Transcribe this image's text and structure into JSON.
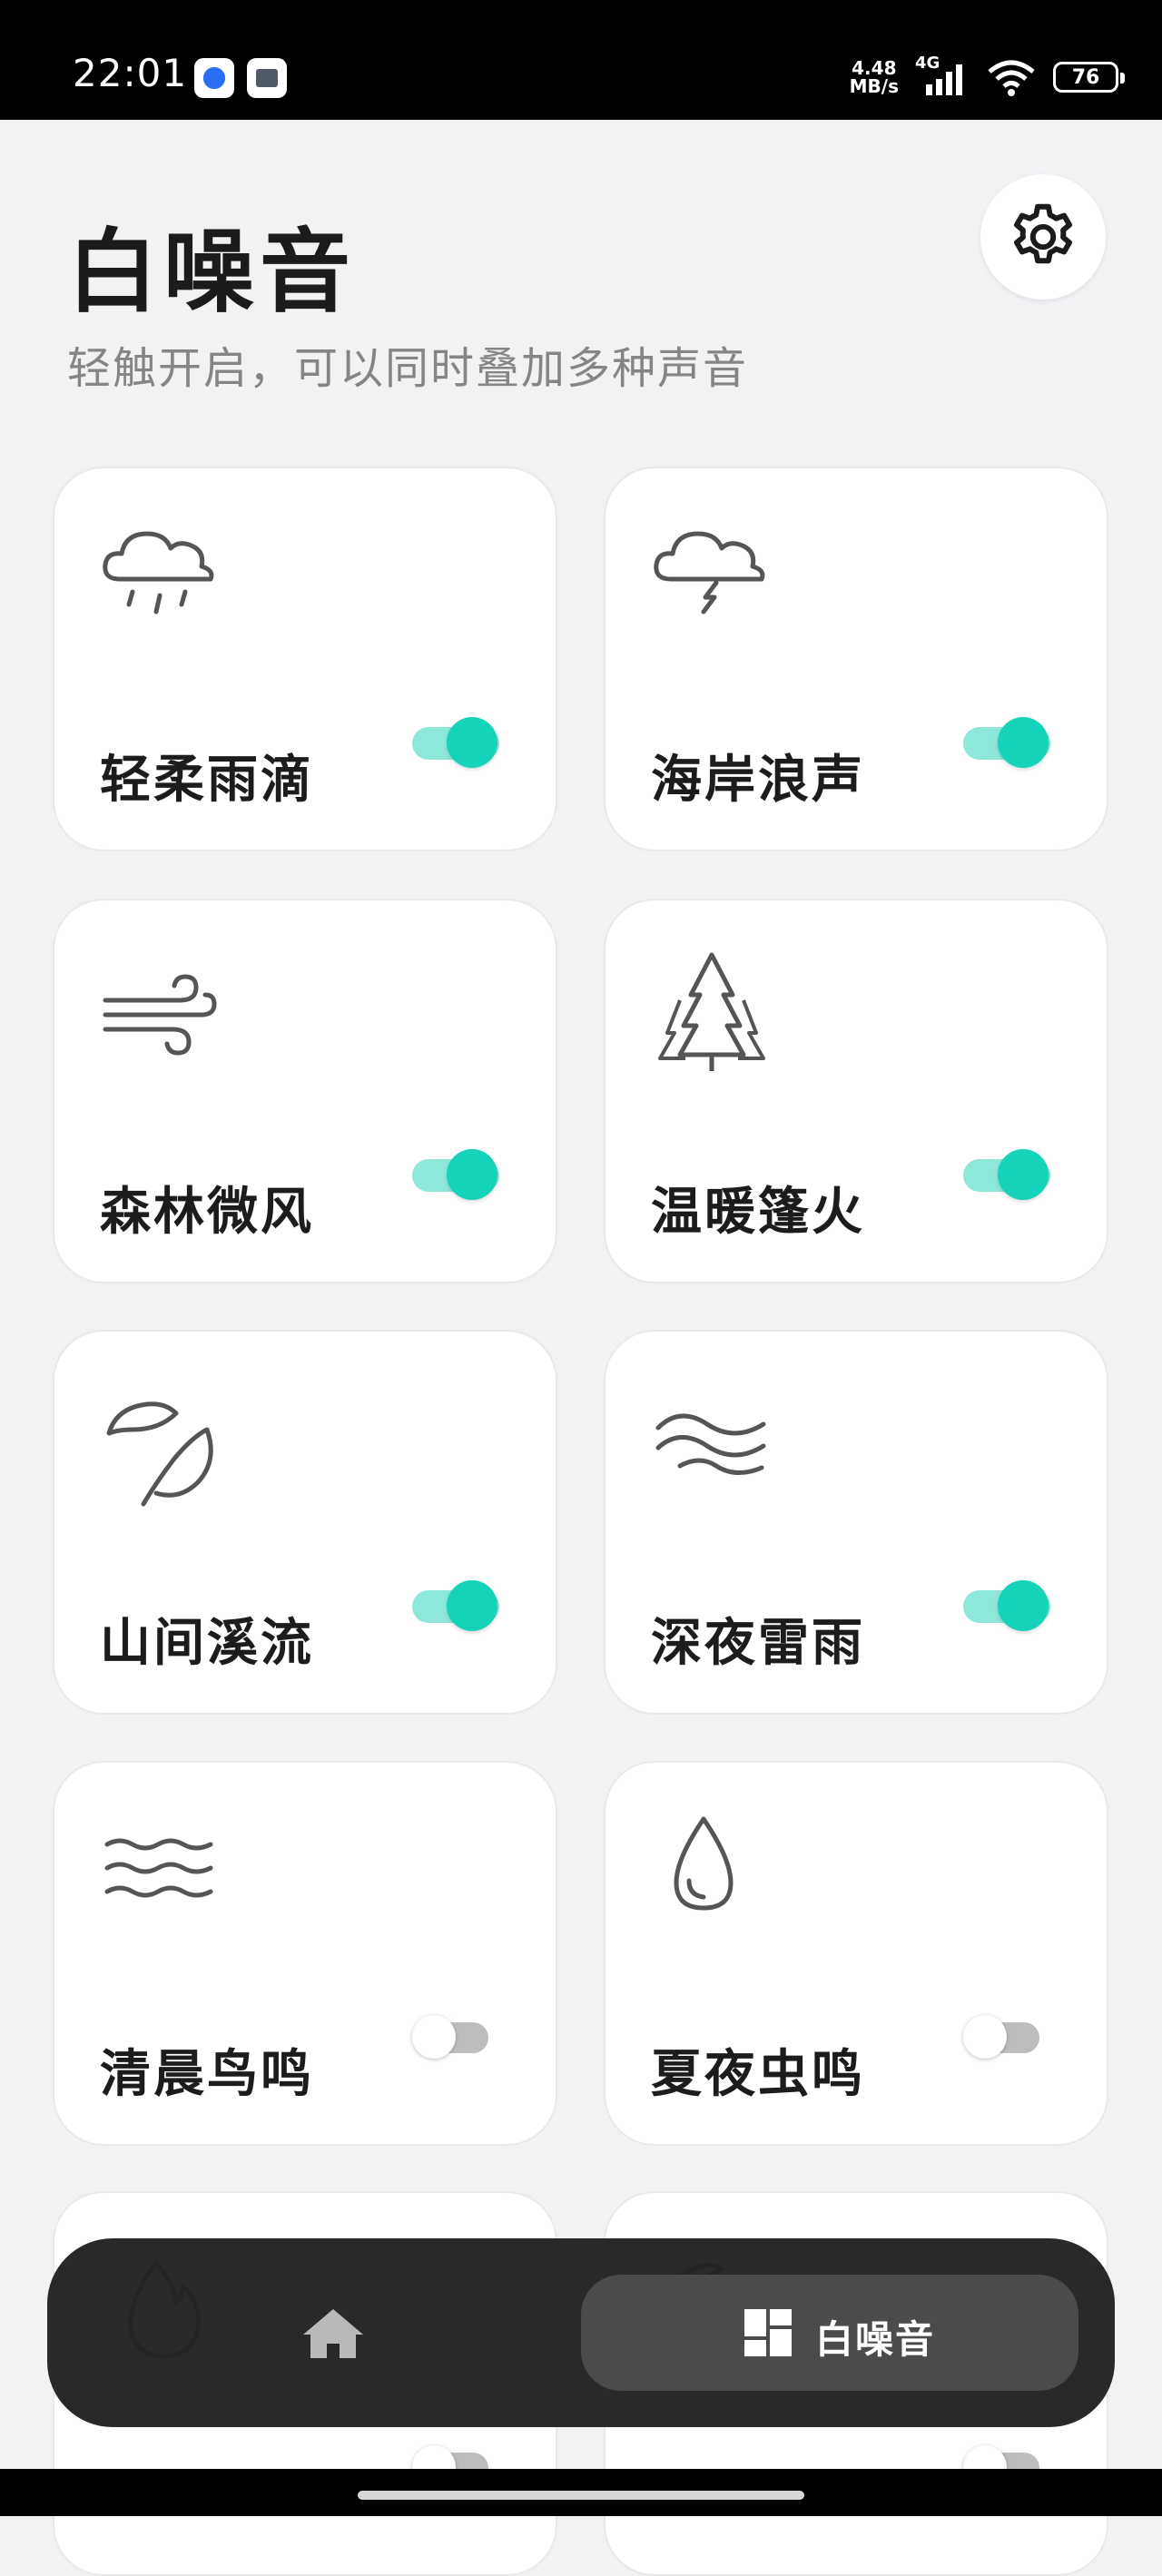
{
  "status_bar": {
    "time": "22:01",
    "speed_value": "4.48",
    "speed_unit": "MB/s",
    "network": "4G",
    "battery": "76"
  },
  "header": {
    "title": "白噪音",
    "subtitle": "轻触开启，可以同时叠加多种声音",
    "settings_icon": "gear-icon"
  },
  "sounds": [
    {
      "name": "轻柔雨滴",
      "icon": "rain-cloud-icon",
      "enabled": true
    },
    {
      "name": "海岸浪声",
      "icon": "thunder-cloud-icon",
      "enabled": true
    },
    {
      "name": "森林微风",
      "icon": "wind-icon",
      "enabled": true
    },
    {
      "name": "温暖篷火",
      "icon": "pine-trees-icon",
      "enabled": true
    },
    {
      "name": "山间溪流",
      "icon": "leaf-icon",
      "enabled": true
    },
    {
      "name": "深夜雷雨",
      "icon": "waves-icon",
      "enabled": true
    },
    {
      "name": "清晨鸟鸣",
      "icon": "water-lines-icon",
      "enabled": false
    },
    {
      "name": "夏夜虫鸣",
      "icon": "water-drop-icon",
      "enabled": false
    },
    {
      "name": "",
      "icon": "flame-icon",
      "enabled": false
    },
    {
      "name": "",
      "icon": "moon-icon",
      "enabled": false
    }
  ],
  "bottom_nav": {
    "home_icon": "home-icon",
    "active_icon": "grid-icon",
    "active_label": "白噪音"
  },
  "colors": {
    "accent": "#14d3b8",
    "accent_track": "#8ee8d9",
    "background": "#f2f2f5",
    "nav_background": "#222222"
  }
}
